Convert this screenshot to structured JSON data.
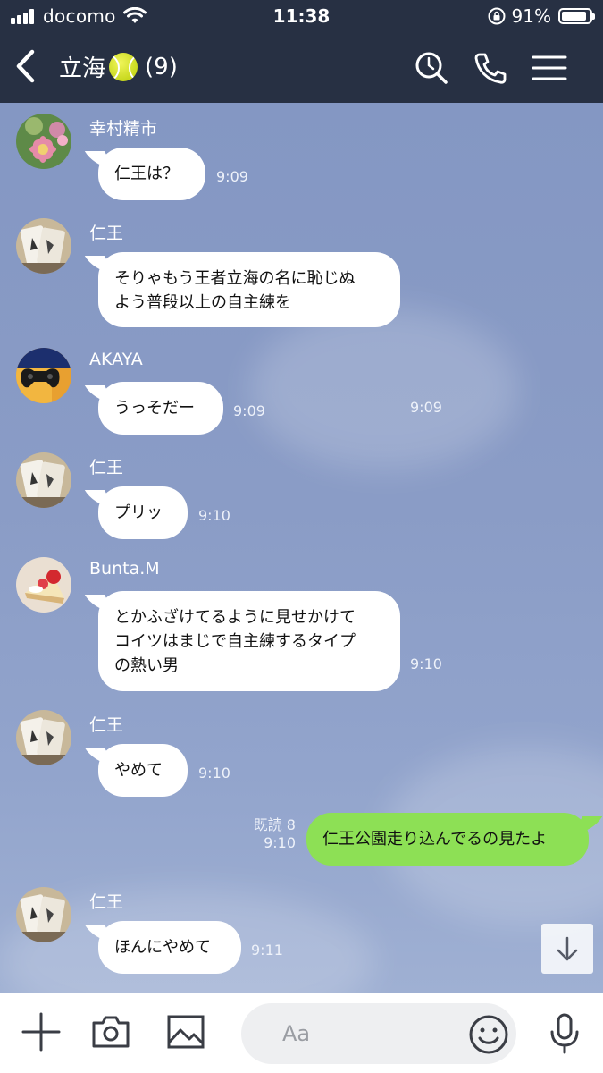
{
  "status_bar": {
    "carrier": "docomo",
    "time": "11:38",
    "battery": "91%",
    "battery_level": 0.91
  },
  "header": {
    "title": "立海",
    "title_icon": "tennis-ball-icon",
    "member_count": "(9)"
  },
  "messages": [
    {
      "sender": "幸村精市",
      "text": [
        "仁王は？"
      ],
      "time": "9:09",
      "avatar": "flower-avatar"
    },
    {
      "sender": "仁王",
      "text": [
        "そりゃもう王者立海の名に恥じぬ",
        "よう普段以上の自主練を"
      ],
      "time": "9:09",
      "avatar": "card-avatar"
    },
    {
      "sender": "AKAYA",
      "text": [
        "うっそだー"
      ],
      "time": "9:09",
      "avatar": "controller-avatar"
    },
    {
      "sender": "仁王",
      "text": [
        "プリッ"
      ],
      "time": "9:10",
      "avatar": "card-avatar"
    },
    {
      "sender": "Bunta.M",
      "text": [
        "とかふざけてるように見せかけて",
        "コイツはまじで自主練するタイプ",
        "の熱い男"
      ],
      "time": "9:10",
      "avatar": "cake-avatar"
    },
    {
      "sender": "仁王",
      "text": [
        "やめて"
      ],
      "time": "9:10",
      "avatar": "card-avatar"
    },
    {
      "sender": "",
      "text": [
        "仁王公園走り込んでるの見たよ"
      ],
      "time": "9:10",
      "read_status": "既読 8",
      "mine": true
    },
    {
      "sender": "仁王",
      "text": [
        "ほんにやめて"
      ],
      "time": "9:11",
      "avatar": "card-avatar"
    }
  ],
  "input": {
    "placeholder": "Aa"
  },
  "colors": {
    "header_bg": "#273043",
    "chat_bg": "#8a9cc6",
    "my_bubble": "#8de055",
    "other_bubble": "#ffffff"
  }
}
